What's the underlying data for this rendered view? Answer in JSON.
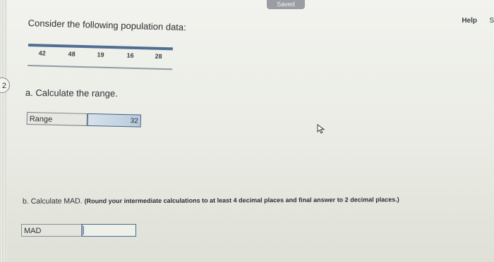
{
  "header": {
    "saved_label": "Saved",
    "help_label": "Help",
    "help_extra": "S"
  },
  "question": {
    "number": "2",
    "prompt": "Consider the following population data:",
    "data_values": [
      "42",
      "48",
      "19",
      "16",
      "28"
    ]
  },
  "part_a": {
    "prompt": "a. Calculate the range.",
    "field_label": "Range",
    "field_value": "32"
  },
  "part_b": {
    "prompt": "b. Calculate MAD.",
    "instruction": "(Round your intermediate calculations to at least 4 decimal places and final answer to 2 decimal places.)",
    "field_label": "MAD",
    "field_value": ""
  },
  "icons": {
    "cursor": "mouse-pointer-icon"
  }
}
